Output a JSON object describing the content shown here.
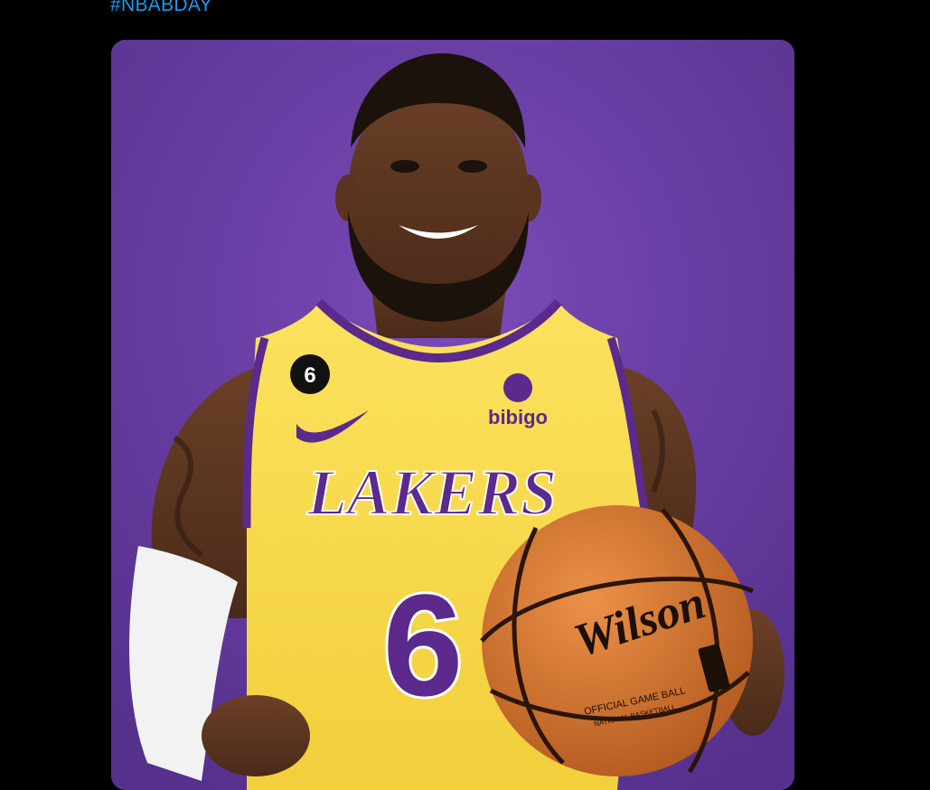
{
  "post": {
    "hashtag": "#NBABDAY",
    "link_color": "#1d9bf0"
  },
  "media": {
    "background_color": "#6a3ea6",
    "jersey": {
      "team_wordmark": "LAKERS",
      "number": "6",
      "patch_number": "6",
      "sponsor": "bibigo",
      "primary_color": "#f7d94c",
      "trim_color": "#5b2a8c"
    },
    "basketball": {
      "brand": "Wilson",
      "stamp_line_1": "OFFICIAL GAME BALL",
      "stamp_line_2": "NATIONAL BASKETBALL",
      "color": "#d9782f"
    }
  }
}
